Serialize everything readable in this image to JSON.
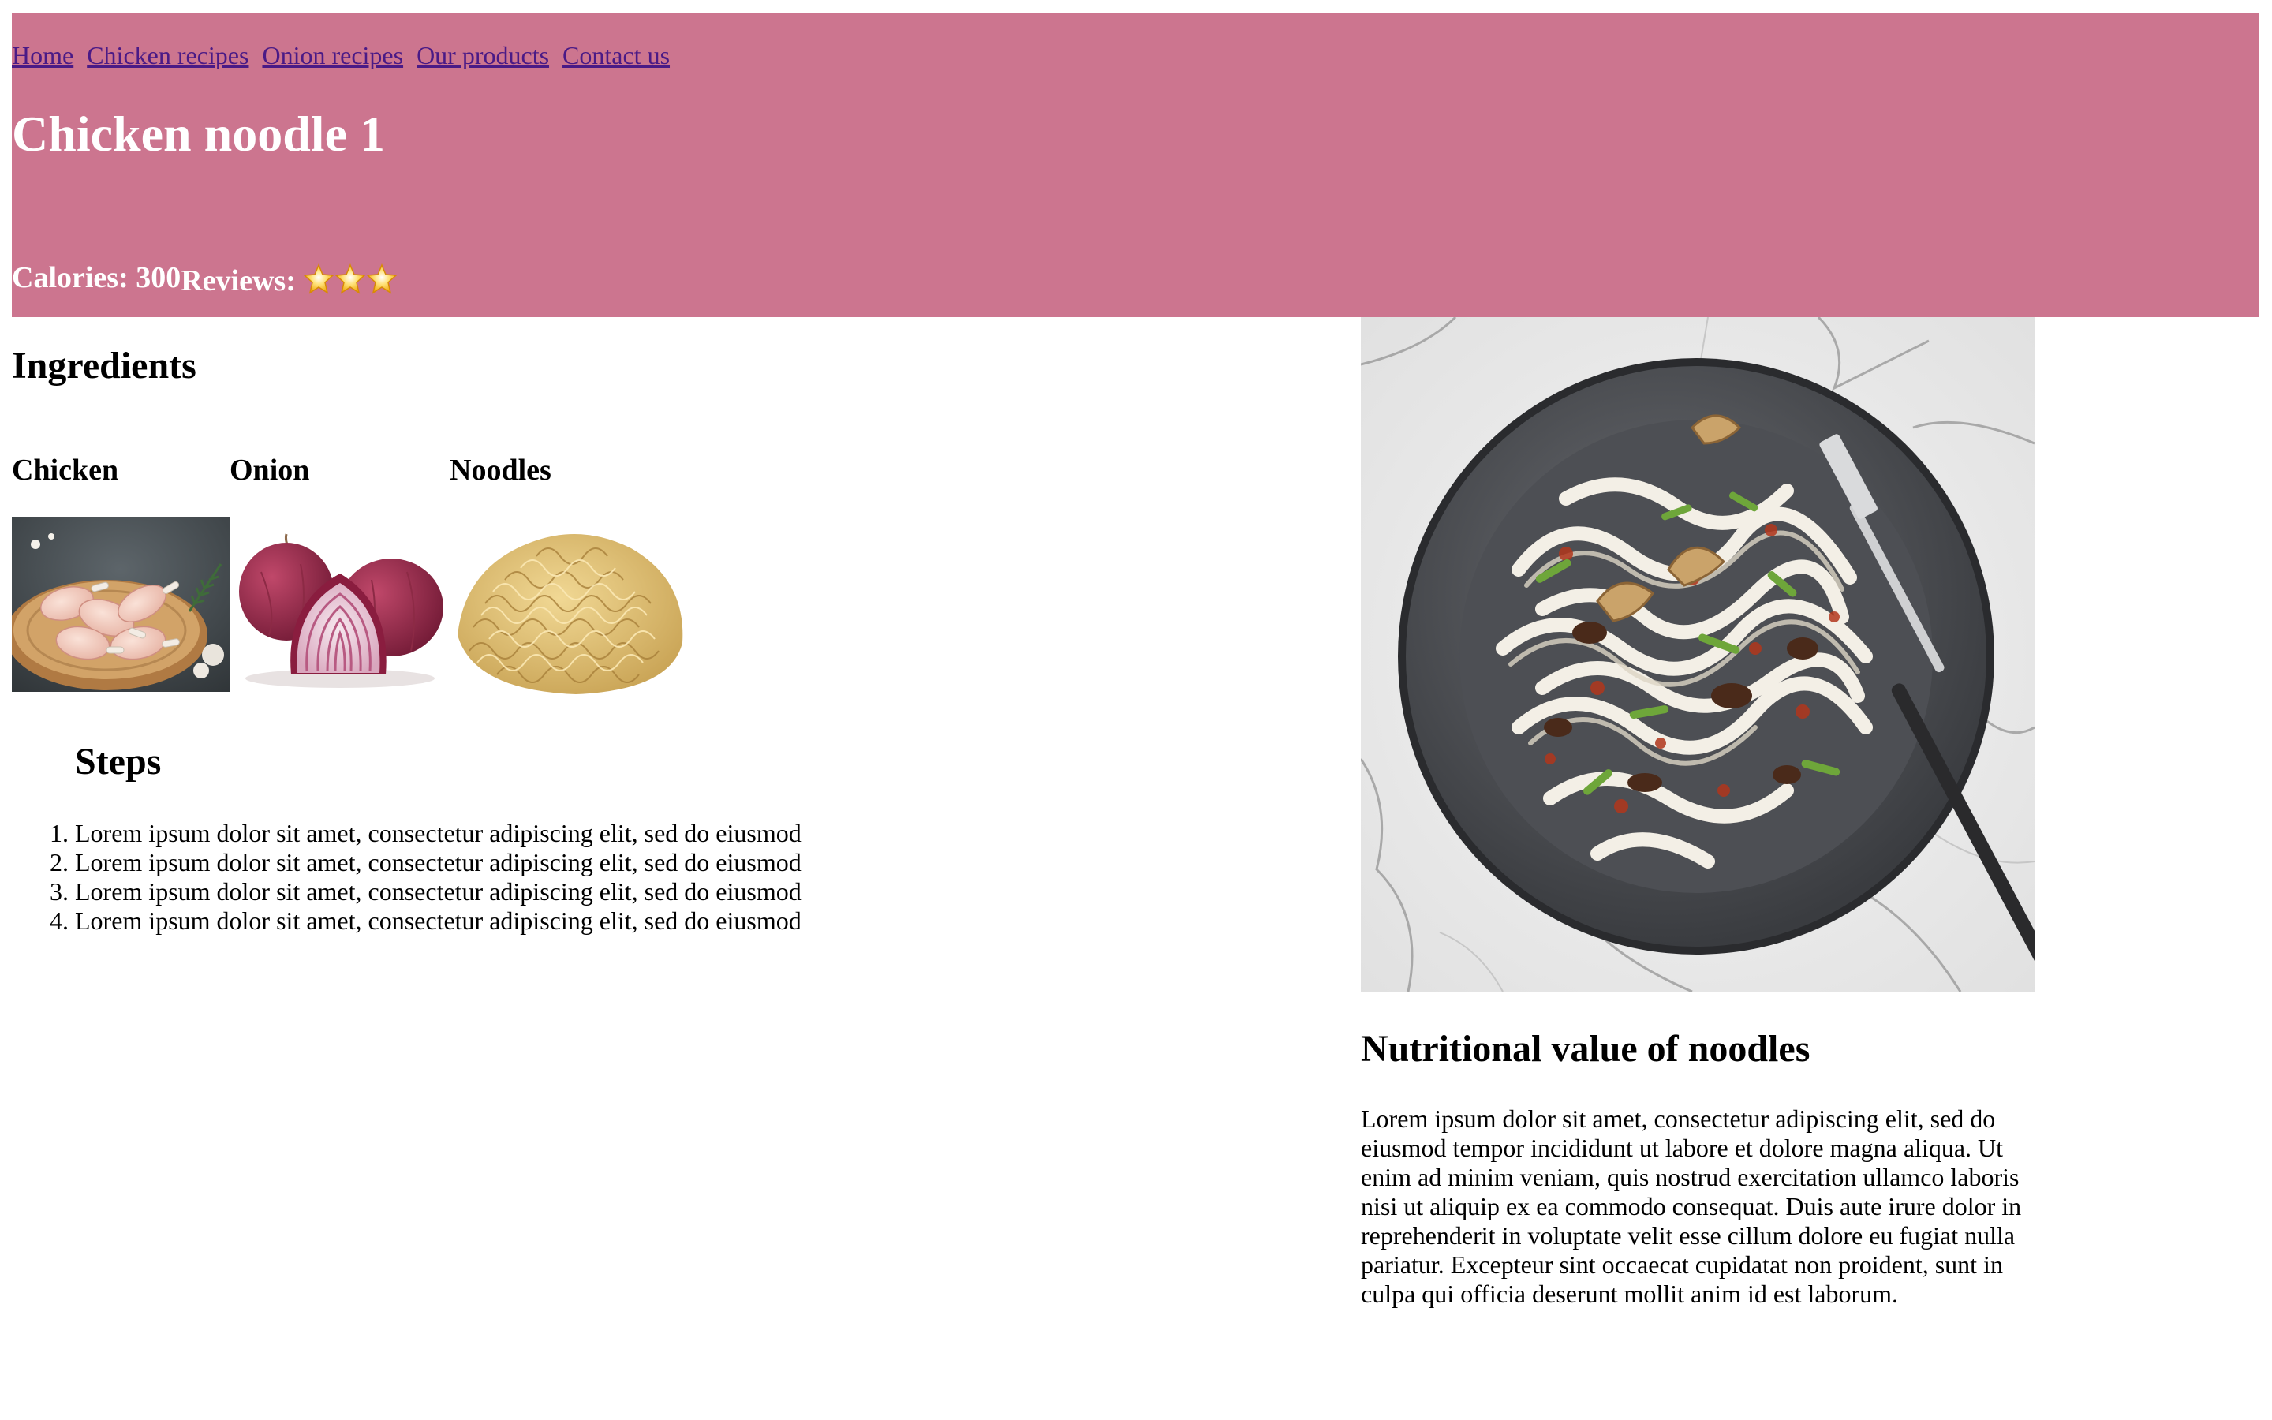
{
  "nav": {
    "items": [
      "Home",
      "Chicken recipes",
      "Onion recipes",
      "Our products",
      "Contact us"
    ]
  },
  "header": {
    "title": "Chicken noodle 1",
    "calories": "Calories: 300",
    "reviews_label": "Reviews:",
    "stars": 3
  },
  "ingredients": {
    "title": "Ingredients",
    "items": [
      "Chicken",
      "Onion",
      "Noodles"
    ]
  },
  "steps": {
    "title": "Steps",
    "items": [
      "Lorem ipsum dolor sit amet, consectetur adipiscing elit, sed do eiusmod",
      "Lorem ipsum dolor sit amet, consectetur adipiscing elit, sed do eiusmod",
      "Lorem ipsum dolor sit amet, consectetur adipiscing elit, sed do eiusmod",
      "Lorem ipsum dolor sit amet, consectetur adipiscing elit, sed do eiusmod"
    ]
  },
  "nutrition": {
    "title": "Nutritional value of noodles",
    "text": "Lorem ipsum dolor sit amet, consectetur adipiscing elit, sed do eiusmod tempor incididunt ut labore et dolore magna aliqua. Ut enim ad minim veniam, quis nostrud exercitation ullamco laboris nisi ut aliquip ex ea commodo consequat. Duis aute irure dolor in reprehenderit in voluptate velit esse cillum dolore eu fugiat nulla pariatur. Excepteur sint occaecat cupidatat non proident, sunt in culpa qui officia deserunt mollit anim id est laborum."
  },
  "colors": {
    "header_bg": "#cc758f",
    "link": "#4a1a86",
    "header_text": "#ffffff"
  },
  "icons": {
    "review_star": "star-icon"
  }
}
